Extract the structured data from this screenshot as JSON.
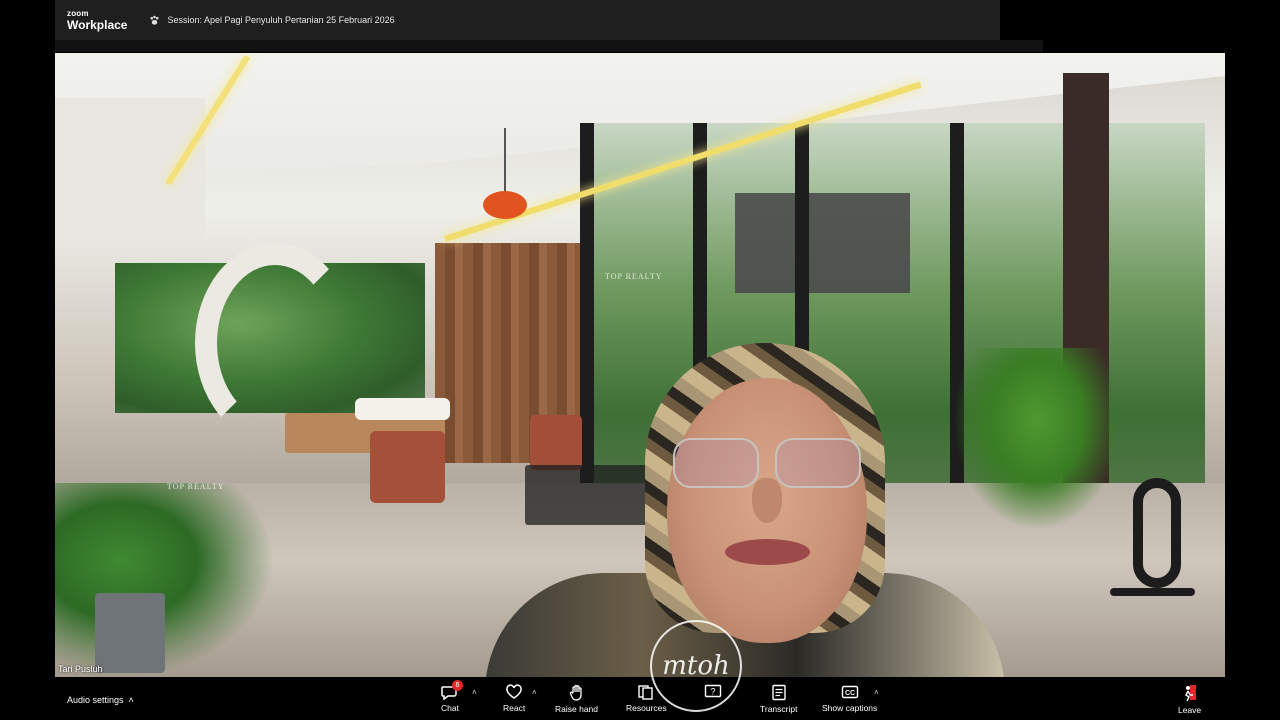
{
  "app": {
    "brand_small": "zoom",
    "brand_large": "Workplace",
    "session_title": "Session: Apel Pagi Penyuluh Pertanian 25 Februari 2026"
  },
  "video": {
    "participant_name": "Tari Pusluh",
    "watermark_left": "TOP REALTY",
    "watermark_center": "TOP REALTY"
  },
  "toolbar": {
    "audio_settings_label": "Audio settings",
    "chat_label": "Chat",
    "chat_badge": "6",
    "react_label": "React",
    "raise_hand_label": "Raise hand",
    "resources_label": "Resources",
    "transcript_label": "Transcript",
    "show_captions_label": "Show captions",
    "leave_label": "Leave"
  },
  "colors": {
    "topbar_bg": "#1f1f1f",
    "toolbar_bg": "#000000",
    "badge_red": "#e02828",
    "leave_accent": "#e02828"
  },
  "icons": [
    "paw-icon",
    "chat-icon",
    "react-heart-icon",
    "raise-hand-icon",
    "resources-icon",
    "question-icon",
    "transcript-icon",
    "captions-icon",
    "leave-icon",
    "caret-up-icon"
  ]
}
